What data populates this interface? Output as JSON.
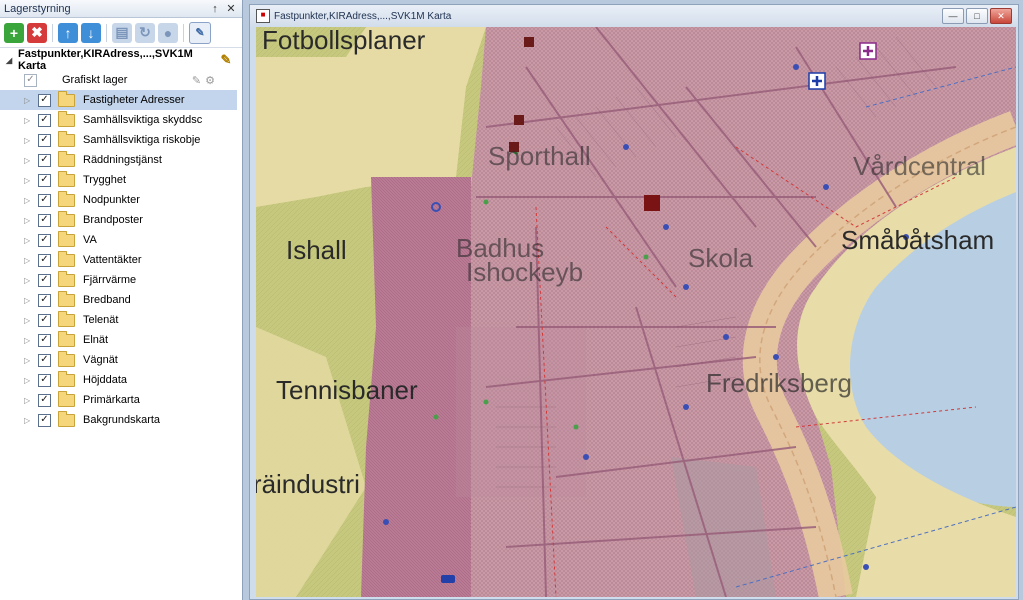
{
  "panel": {
    "title": "Lagerstyrning",
    "pin_symbol": "↑",
    "close_symbol": "✕",
    "toolbar": {
      "add_icon": "plus-icon",
      "remove_icon": "x-icon",
      "add_symbol": "+",
      "remove_symbol": "✖",
      "up_symbol": "↑",
      "down_symbol": "↓"
    },
    "root_label": "Fastpunkter,KIRAdress,...,SVK1M Karta",
    "grafiskt_label": "Grafiskt lager",
    "layers": [
      {
        "label": "Fastigheter Adresser",
        "checked": true,
        "selected": true
      },
      {
        "label": "Samhällsviktiga skyddsc",
        "checked": true
      },
      {
        "label": "Samhällsviktiga riskobje",
        "checked": true
      },
      {
        "label": "Räddningstjänst",
        "checked": true
      },
      {
        "label": "Trygghet",
        "checked": true
      },
      {
        "label": "Nodpunkter",
        "checked": true
      },
      {
        "label": "Brandposter",
        "checked": true
      },
      {
        "label": "VA",
        "checked": true
      },
      {
        "label": "Vattentäkter",
        "checked": true
      },
      {
        "label": "Fjärrvärme",
        "checked": true
      },
      {
        "label": "Bredband",
        "checked": true
      },
      {
        "label": "Telenät",
        "checked": true
      },
      {
        "label": "Elnät",
        "checked": true
      },
      {
        "label": "Vägnät",
        "checked": true
      },
      {
        "label": "Höjddata",
        "checked": true
      },
      {
        "label": "Primärkarta",
        "checked": true
      },
      {
        "label": "Bakgrundskarta",
        "checked": true
      }
    ]
  },
  "mapwindow": {
    "title": "Fastpunkter,KIRAdress,...,SVK1M Karta",
    "map_labels": {
      "fotboll": "Fotbollsplaner",
      "sporthall": "Sporthall",
      "vardcentral": "Vårdcentral",
      "ishall": "Ishall",
      "badhus": "Badhus",
      "ishockey": "Ishockeyb",
      "skola": "Skola",
      "smabatshamn": "Småbåtsham",
      "tennis": "Tennisbaner",
      "fredriksberg": "Fredriksberg",
      "industri": "Träindustri"
    }
  },
  "colors": {
    "parcel": "#c9a0ac",
    "parcel_dense": "#b77d95",
    "road": "#e6c8a0",
    "green": "#c8ce86",
    "water": "#b8cfe3",
    "sand": "#e8dca8"
  }
}
